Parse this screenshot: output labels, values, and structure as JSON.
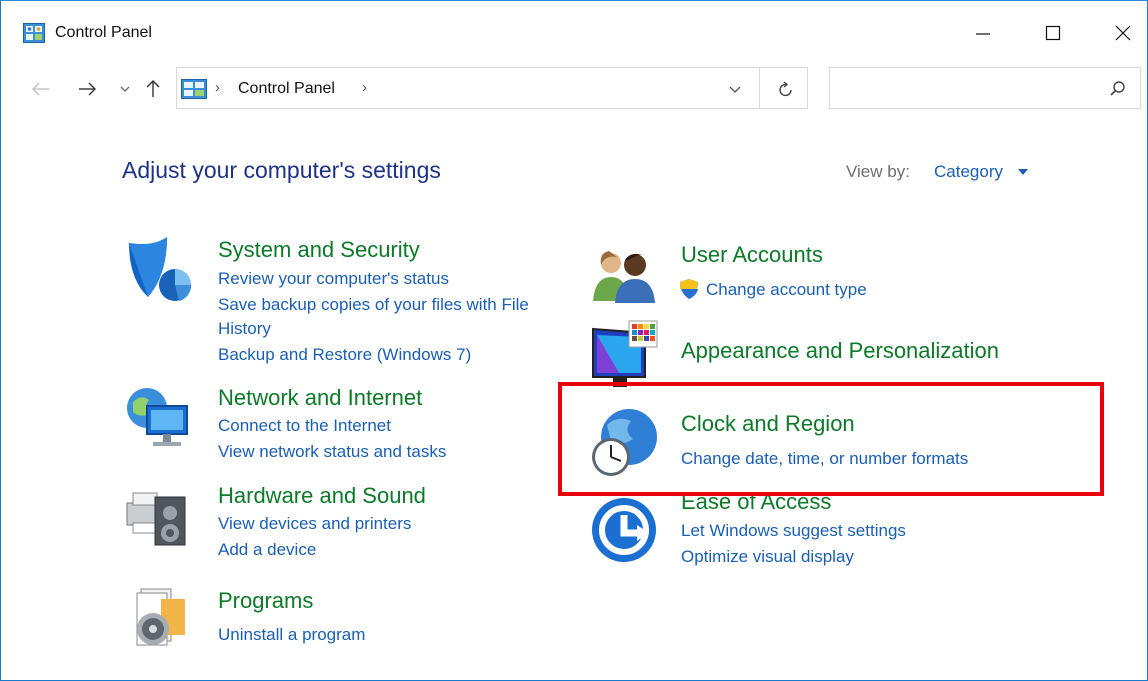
{
  "window": {
    "title": "Control Panel"
  },
  "nav": {
    "breadcrumb": "Control Panel",
    "separator": "›",
    "search_placeholder": ""
  },
  "main": {
    "heading": "Adjust your computer's settings",
    "view_by_label": "View by:",
    "view_by_value": "Category"
  },
  "categories": [
    {
      "title": "System and Security",
      "icon": "shield-icon",
      "links": [
        "Review your computer's status",
        "Save backup copies of your files with File",
        "History",
        "Backup and Restore (Windows 7)"
      ]
    },
    {
      "title": "Network and Internet",
      "icon": "network-globe-icon",
      "links": [
        "Connect to the Internet",
        "View network status and tasks"
      ]
    },
    {
      "title": "Hardware and Sound",
      "icon": "printer-speaker-icon",
      "links": [
        "View devices and printers",
        "Add a device"
      ]
    },
    {
      "title": "Programs",
      "icon": "programs-disc-icon",
      "links": [
        "Uninstall a program"
      ]
    },
    {
      "title": "User Accounts",
      "icon": "users-icon",
      "links": [
        "Change account type"
      ]
    },
    {
      "title": "Appearance and Personalization",
      "icon": "monitor-palette-icon",
      "links": []
    },
    {
      "title": "Clock and Region",
      "icon": "clock-globe-icon",
      "links": [
        "Change date, time, or number formats"
      ]
    },
    {
      "title": "Ease of Access",
      "icon": "ease-of-access-icon",
      "links": [
        "Let Windows suggest settings",
        "Optimize visual display"
      ]
    }
  ],
  "colors": {
    "category_title": "#0c7a28",
    "link": "#1a5fb4",
    "heading": "#1e3287",
    "highlight": "#e8000b"
  }
}
